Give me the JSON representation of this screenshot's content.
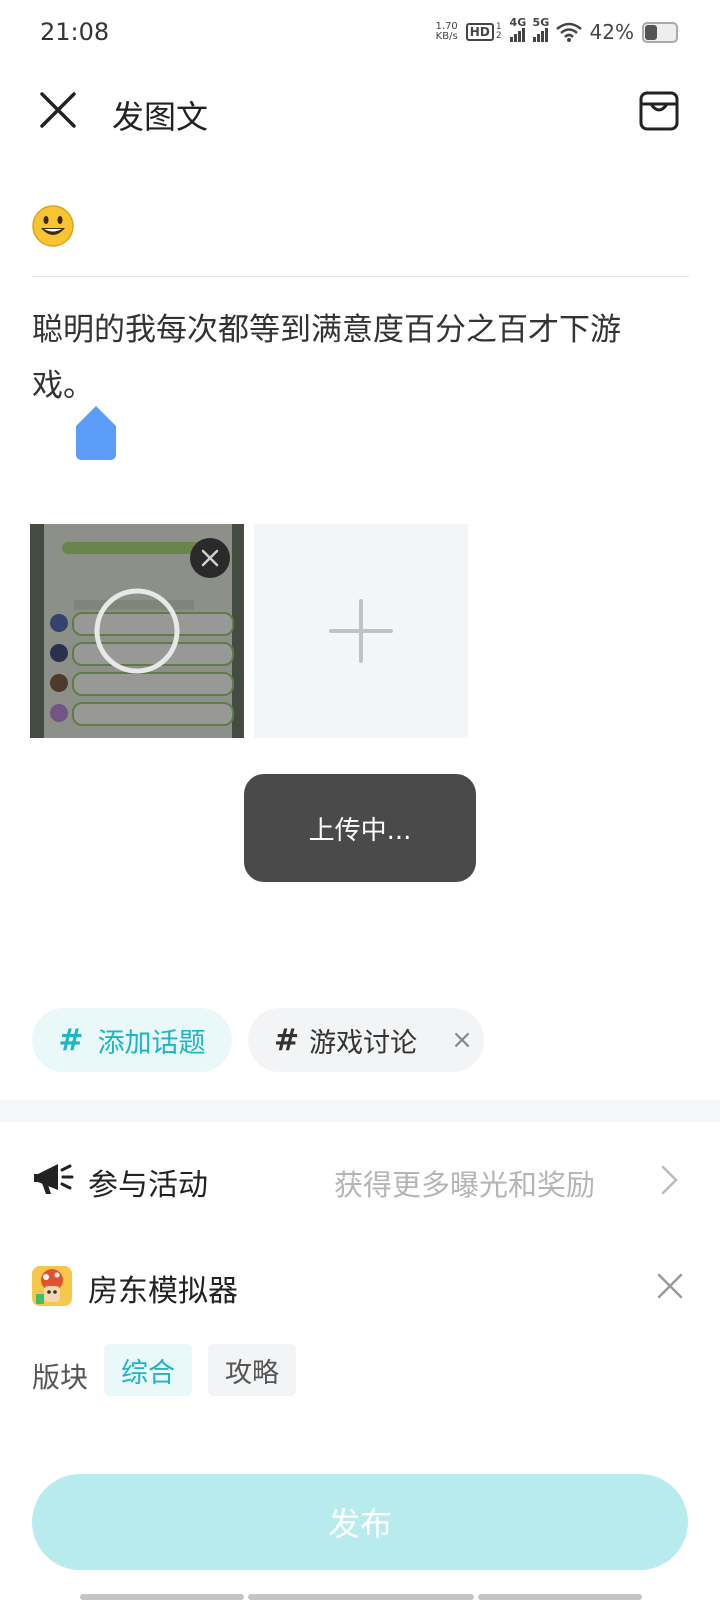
{
  "status": {
    "time": "21:08",
    "net_speed_value": "1.70",
    "net_speed_unit": "KB/s",
    "hd_label": "HD",
    "hd_sub": "1",
    "hd_sub2": "2",
    "gen1": "4G",
    "gen2": "5G",
    "battery_text": "42%",
    "battery_level": 0.42
  },
  "header": {
    "title": "发图文"
  },
  "editor": {
    "content": "聪明的我每次都等到满意度百分之百才下游戏。"
  },
  "upload": {
    "toast": "上传中...",
    "progress": 0.0
  },
  "topics": {
    "add_label": "添加话题",
    "hash": "#",
    "selected": "游戏讨论",
    "remove": "×"
  },
  "activity": {
    "label": "参与活动",
    "hint": "获得更多曝光和奖励"
  },
  "game": {
    "name": "房东模拟器"
  },
  "board": {
    "label": "版块",
    "options": [
      "综合",
      "攻略"
    ],
    "selected": "综合"
  },
  "publish": {
    "label": "发布"
  },
  "colors": {
    "accent": "#1fb4c2",
    "publish_disabled": "#b8ebee",
    "toast_bg": "#4a4a4a"
  }
}
